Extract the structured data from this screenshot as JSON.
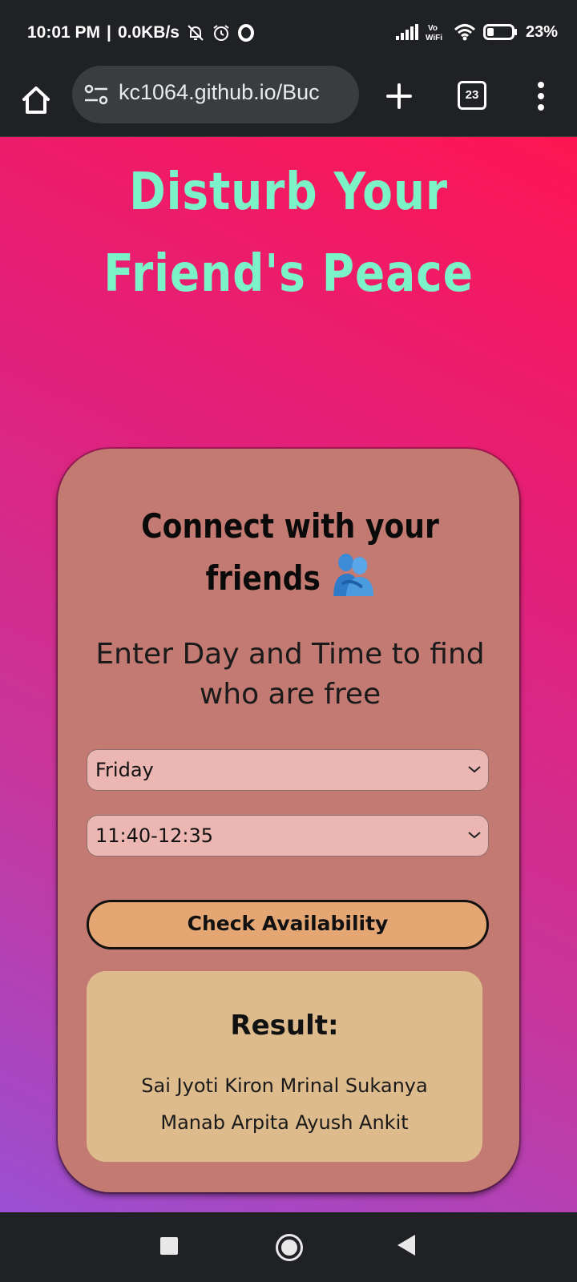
{
  "status_bar": {
    "time": "10:01 PM",
    "network_speed": "0.0KB/s",
    "left_icons": [
      "muted-bell-icon",
      "alarm-clock-icon",
      "opera-icon"
    ],
    "right_icons": [
      "signal-icon",
      "vowifi-icon",
      "wifi-icon",
      "battery-icon"
    ],
    "vowifi_label": "Vo\nWiFi",
    "battery_percent": "23%"
  },
  "browser": {
    "url": "kc1064.github.io/Buc",
    "tab_count": "23",
    "icons": [
      "home-icon",
      "site-settings-icon",
      "plus-icon",
      "tabs-icon",
      "overflow-menu-icon"
    ]
  },
  "page": {
    "title": "Disturb Your Friend's Peace",
    "card": {
      "heading": "Connect with your friends",
      "heading_emoji": "people-hugging-icon",
      "subtitle": "Enter Day and Time to find who are free",
      "day_select": {
        "value": "Friday"
      },
      "time_select": {
        "value": "11:40-12:35"
      },
      "check_button_label": "Check Availability",
      "result": {
        "heading": "Result:",
        "names": "Sai Jyoti Kiron Mrinal Sukanya Manab Arpita Ayush Ankit"
      }
    },
    "colors": {
      "title": "#7cf2c8",
      "card": "#c27a72",
      "select": "#ecb7b2",
      "button": "#e4a673",
      "result_box": "#debb8c"
    }
  },
  "nav_bar": {
    "icons": [
      "recent-apps-icon",
      "home-circle-icon",
      "back-icon"
    ]
  }
}
